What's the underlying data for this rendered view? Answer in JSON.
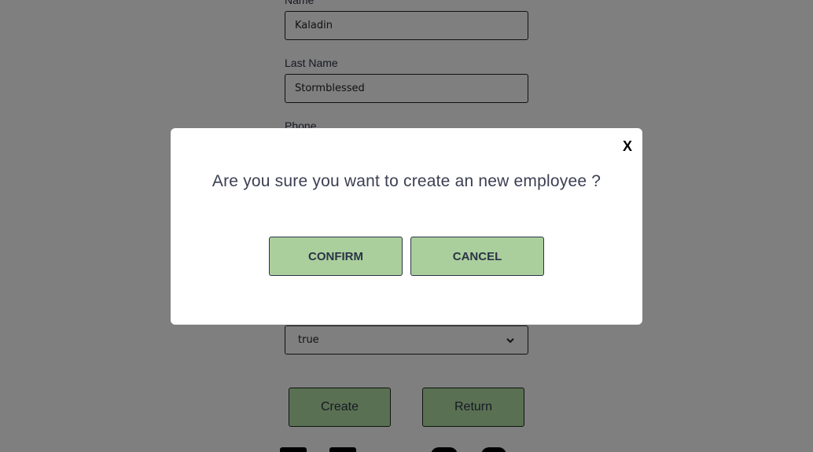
{
  "form": {
    "name_label": "Name",
    "name_value": "Kaladin",
    "lastname_label": "Last Name",
    "lastname_value": "Stormblessed",
    "phone_label": "Phone",
    "status_select_value": "true",
    "create_label": "Create",
    "return_label": "Return"
  },
  "footer": {
    "icons": [
      "social-icon-1",
      "social-icon-2",
      "social-icon-3",
      "social-icon-4"
    ]
  },
  "modal": {
    "close_label": "X",
    "message": "Are you sure you want to create an new employee ?",
    "confirm_label": "CONFIRM",
    "cancel_label": "CANCEL"
  },
  "colors": {
    "overlay": "#808080",
    "button_green": "#aacf9d",
    "text_dark": "#2c3346"
  }
}
